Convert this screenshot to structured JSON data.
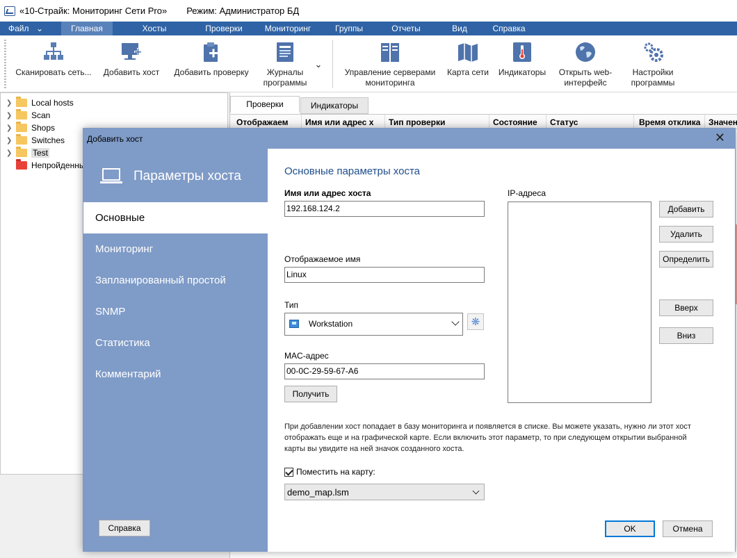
{
  "window": {
    "title": "«10-Страйк: Мониторинг Сети Pro»",
    "mode": "Режим: Администратор БД"
  },
  "menu": {
    "file": "Файл",
    "items": [
      "Главная",
      "Хосты",
      "Проверки",
      "Мониторинг",
      "Группы",
      "Отчеты",
      "Вид",
      "Справка"
    ]
  },
  "ribbon": {
    "buttons": [
      {
        "label": "Сканировать сеть...",
        "icon": "network-scan-icon"
      },
      {
        "label": "Добавить хост",
        "icon": "add-host-icon"
      },
      {
        "label": "Добавить проверку",
        "icon": "add-check-icon"
      },
      {
        "label": "Журналы программы",
        "icon": "logs-icon"
      },
      {
        "label": "Управление серверами мониторинга",
        "icon": "servers-icon"
      },
      {
        "label": "Карта сети",
        "icon": "map-icon"
      },
      {
        "label": "Индикаторы",
        "icon": "thermometer-icon"
      },
      {
        "label": "Открыть web-интерфейс",
        "icon": "globe-icon"
      },
      {
        "label": "Настройки программы",
        "icon": "gears-icon"
      }
    ]
  },
  "tree": {
    "items": [
      {
        "label": "Local hosts",
        "color": "#f6c760"
      },
      {
        "label": "Scan",
        "color": "#f6c760"
      },
      {
        "label": "Shops",
        "color": "#f6c760"
      },
      {
        "label": "Switches",
        "color": "#f6c760"
      },
      {
        "label": "Test",
        "color": "#f6c760"
      },
      {
        "label": "Непройденны",
        "color": "#e8413a"
      }
    ]
  },
  "rightpanel": {
    "tabs": [
      "Проверки",
      "Индикаторы"
    ],
    "columns": [
      "Отображаем",
      "Имя или адрес х",
      "Тип проверки",
      "Состояние",
      "Статус",
      "Время отклика",
      "Значен"
    ]
  },
  "dialog": {
    "title": "Добавить хост",
    "side_header": "Параметры хоста",
    "nav": [
      "Основные",
      "Мониторинг",
      "Запланированный простой",
      "SNMP",
      "Статистика",
      "Комментарий"
    ],
    "help_button": "Справка",
    "section_title": "Основные параметры хоста",
    "host_label": "Имя или адрес хоста",
    "host_value": "192.168.124.2",
    "display_name_label": "Отображаемое имя",
    "display_name_value": "Linux",
    "type_label": "Тип",
    "type_value": "Workstation",
    "mac_label": "MAC-адрес",
    "mac_value": "00-0C-29-59-67-A6",
    "get_button": "Получить",
    "ip_label": "IP-адреса",
    "ip_buttons": [
      "Добавить",
      "Удалить",
      "Определить",
      "Вверх",
      "Вниз"
    ],
    "info_text": "При добавлении хост попадает в базу мониторинга и появляется в списке. Вы можете указать, нужно ли этот хост отображать еще и на графической карте. Если включить этот параметр, то при следующем открытии выбранной карты вы увидите на ней значок созданного хоста.",
    "map_checkbox_label": "Поместить на карту:",
    "map_value": "demo_map.lsm",
    "ok": "OK",
    "cancel": "Отмена"
  },
  "colors": {
    "menubar": "#2f63a5",
    "dialog_side": "#7f9bc7",
    "section_title": "#1f4e8d"
  }
}
